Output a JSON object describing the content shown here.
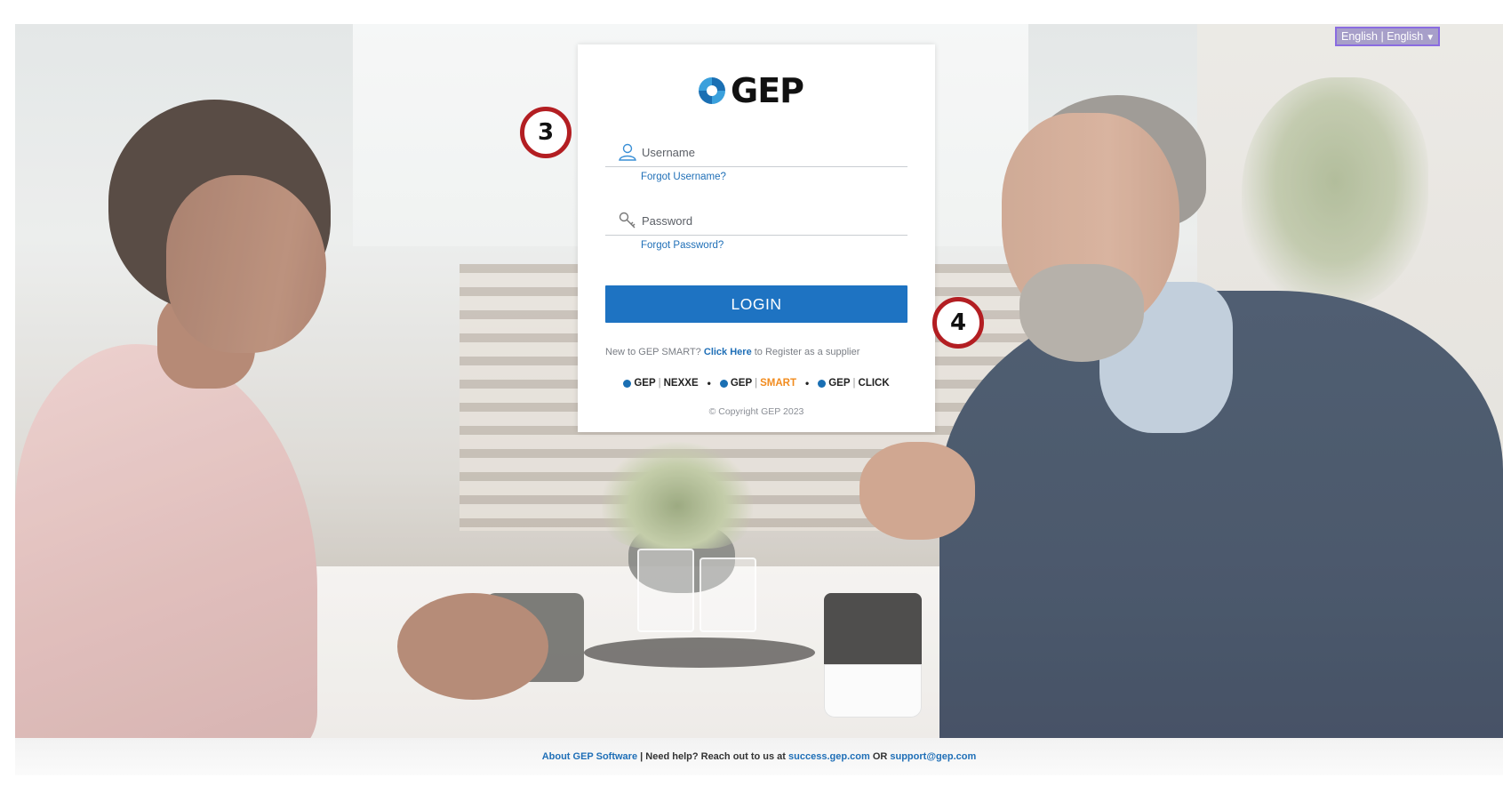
{
  "language": {
    "label": "English | English"
  },
  "logo": {
    "text": "GEP"
  },
  "form": {
    "username_placeholder": "Username",
    "forgot_username": "Forgot Username?",
    "password_placeholder": "Password",
    "forgot_password": "Forgot Password?",
    "login_label": "LOGIN",
    "register_prefix": "New to GEP SMART?",
    "register_link": "Click Here",
    "register_suffix": "to Register as a supplier"
  },
  "brands": [
    {
      "prefix": "GEP",
      "product": "NEXXE",
      "color": "#222222"
    },
    {
      "prefix": "GEP",
      "product": "SMART",
      "color": "#f28c1f"
    },
    {
      "prefix": "GEP",
      "product": "CLICK",
      "color": "#222222"
    }
  ],
  "copyright": "© Copyright GEP 2023",
  "callouts": [
    "3",
    "4"
  ],
  "footer": {
    "about": "About GEP Software",
    "sep": "|",
    "help_text": "Need help? Reach out to us at",
    "success_link": "success.gep.com",
    "or_text": "OR",
    "support_link": "support@gep.com"
  },
  "colors": {
    "primary_blue": "#1e73c2",
    "link_blue": "#1f6fb7",
    "callout_red": "#b31e22",
    "language_border": "#8a6ce0"
  }
}
